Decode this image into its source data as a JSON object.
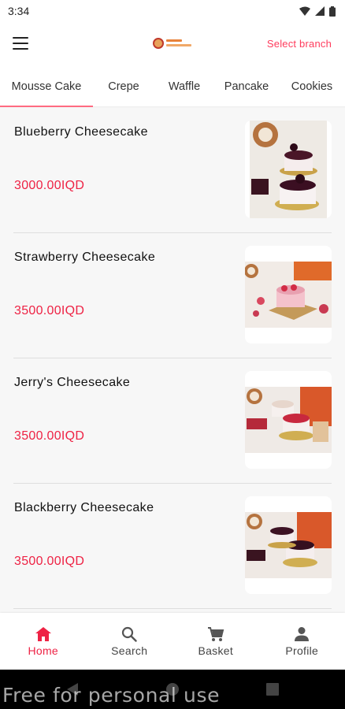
{
  "status_bar": {
    "time": "3:34"
  },
  "header": {
    "select_branch": "Select branch"
  },
  "tabs": [
    {
      "label": "Mousse Cake",
      "active": true
    },
    {
      "label": "Crepe",
      "active": false
    },
    {
      "label": "Waffle",
      "active": false
    },
    {
      "label": "Pancake",
      "active": false
    },
    {
      "label": "Cookies",
      "active": false
    }
  ],
  "products": [
    {
      "name": "Blueberry Cheesecake",
      "price": "3000.00IQD"
    },
    {
      "name": "Strawberry Cheesecake",
      "price": "3500.00IQD"
    },
    {
      "name": "Jerry's Cheesecake",
      "price": "3500.00IQD"
    },
    {
      "name": "Blackberry Cheesecake",
      "price": "3500.00IQD"
    }
  ],
  "bottom_nav": [
    {
      "label": "Home",
      "icon": "home-icon",
      "active": true
    },
    {
      "label": "Search",
      "icon": "search-icon",
      "active": false
    },
    {
      "label": "Basket",
      "icon": "cart-icon",
      "active": false
    },
    {
      "label": "Profile",
      "icon": "person-icon",
      "active": false
    }
  ],
  "watermark": "Free for personal use",
  "colors": {
    "accent": "#ee2244",
    "tab_indicator": "#ff6b81"
  }
}
